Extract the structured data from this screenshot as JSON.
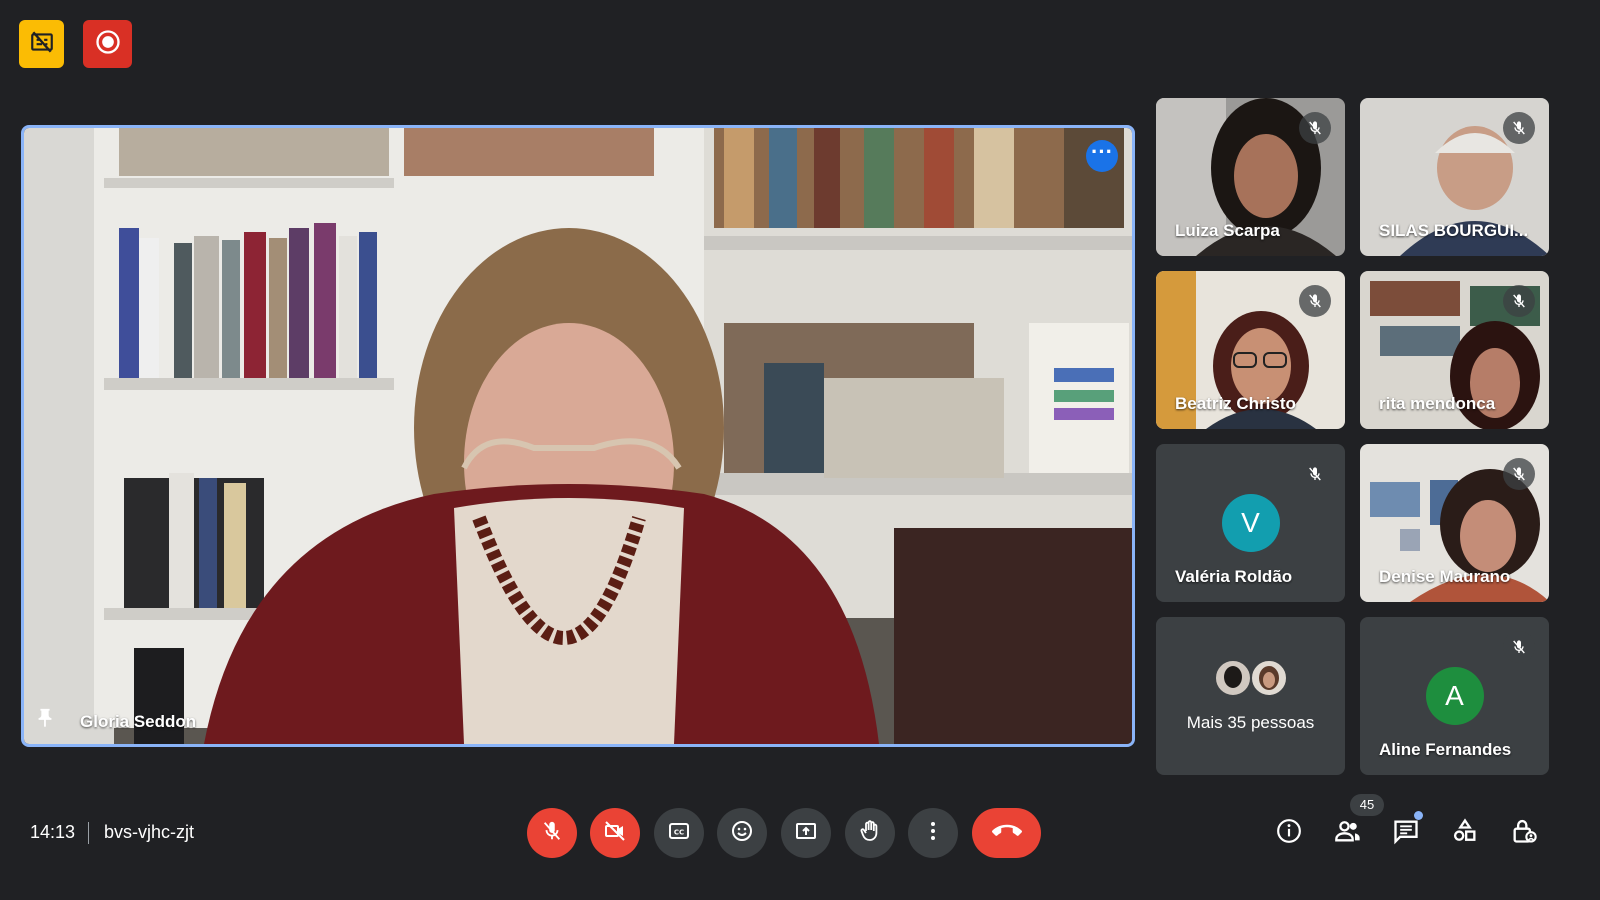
{
  "meeting": {
    "time": "14:13",
    "code": "bvs-vjhc-zjt"
  },
  "main_speaker": {
    "name": "Gloria Seddon",
    "pinned": true
  },
  "participants": [
    {
      "name": "Luiza Scarpa",
      "muted": true,
      "video": true
    },
    {
      "name": "SILAS BOURGUI...",
      "muted": true,
      "video": true
    },
    {
      "name": "Beatriz Christo",
      "muted": true,
      "video": true
    },
    {
      "name": "rita mendonca",
      "muted": true,
      "video": true
    },
    {
      "name": "Valéria Roldão",
      "muted": true,
      "video": false,
      "initial": "V",
      "avatar_color": "#129eaf"
    },
    {
      "name": "Denise Maurano",
      "muted": true,
      "video": true
    },
    {
      "name": "Aline Fernandes",
      "muted": true,
      "video": false,
      "initial": "A",
      "avatar_color": "#1e8e3e"
    }
  ],
  "more_people": {
    "label": "Mais 35 pessoas"
  },
  "people_count": "45",
  "icons": {
    "top_left_1": "no-captions-badge-icon",
    "top_left_2": "recording-icon",
    "controls": [
      "mic-off-icon",
      "video-off-icon",
      "closed-captions-icon",
      "emoji-icon",
      "present-screen-icon",
      "raise-hand-icon",
      "more-options-icon",
      "end-call-icon"
    ],
    "right": [
      "info-icon",
      "people-icon",
      "chat-icon",
      "activities-icon",
      "host-controls-icon"
    ]
  },
  "colors": {
    "background": "#202124",
    "end_call": "#ea4335",
    "active_border": "#8ab4f8",
    "badge_yellow": "#fbbc04",
    "record_red": "#d93025"
  }
}
